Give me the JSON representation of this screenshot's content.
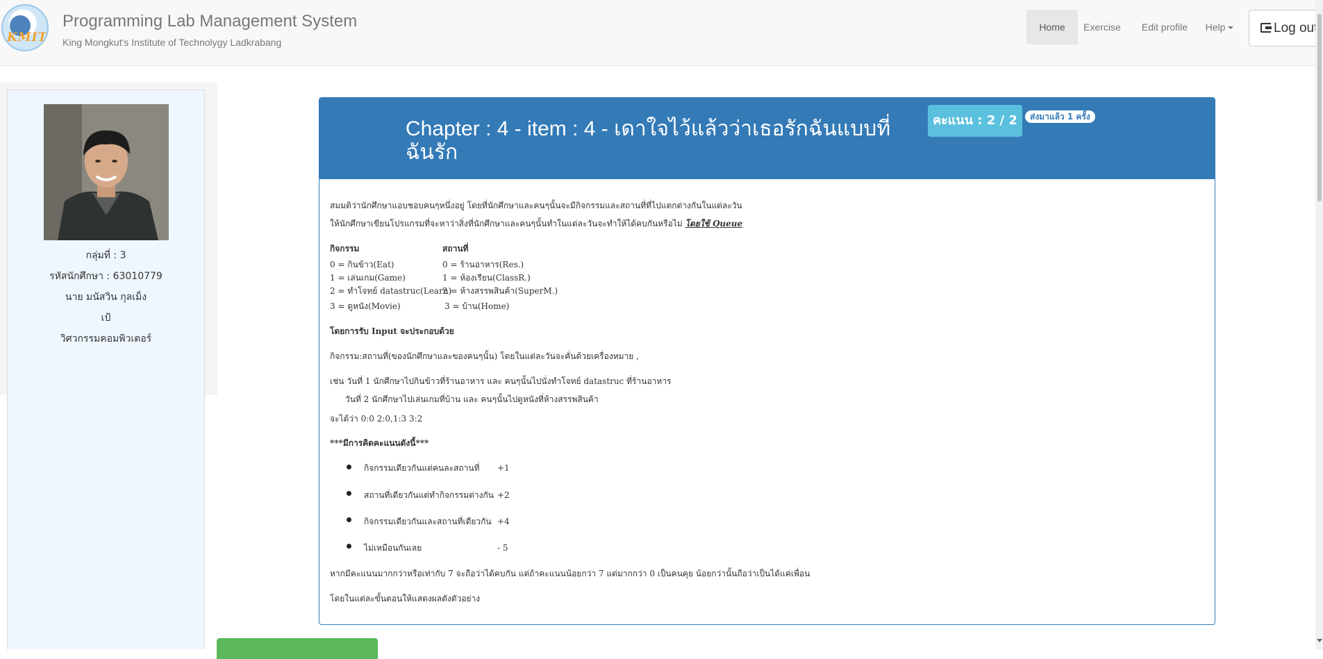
{
  "header": {
    "title": "Programming Lab Management System",
    "subtitle": "King Mongkut's Institute of Technolygy Ladkrabang",
    "logo_text": "KMITL",
    "nav": {
      "home": "Home",
      "exercise": "Exercise",
      "edit_profile": "Edit profile",
      "help": "Help",
      "logout": "Log out"
    }
  },
  "profile": {
    "group": "กลุ่มที่ : 3",
    "student_id": "รหัสนักศึกษา : 63010779",
    "name": "นาย มนัสวิน กุลเม็ง",
    "nickname": "เป้",
    "faculty": "วิศวกรรมคอมพิวเตอร์"
  },
  "problem": {
    "title": "Chapter : 4 - item : 4 - เดาใจไว้แล้วว่าเธอรักฉันแบบที่ฉันรัก",
    "score": "คะแนน : 2 / 2",
    "submitted": "ส่งมาแล้ว 1 ครั้ง",
    "intro1": "สมมติว่านักศึกษาแอบชอบคนๆหนึ่งอยู่ โดยที่นักศึกษาและคนๆนั้นจะมีกิจกรรมและสถานที่ที่ไปแตกต่างกันในแต่ละวัน",
    "intro2": "ให้นักศึกษาเขียนโปรแกรมที่จะหาว่าสิ่งที่นักศึกษาและคนๆนั้นทำในแต่ละวันจะทำให้ได้คบกันหรือไม่ ",
    "intro2_emph": "โดยใช้ Queue",
    "table": {
      "head_activity": "กิจกรรม",
      "head_place": "สถานที่",
      "activities": [
        "0 = กินข้าว(Eat)",
        "1 = เล่นเกม(Game)",
        "2 = ทำโจทย์ datastruc(Learn)",
        "3 = ดูหนัง(Movie)"
      ],
      "places": [
        "0 = ร้านอาหาร(Res.)",
        "1 = ห้องเรียน(ClassR.)",
        "2 = ห้างสรรพสินค้า(SuperM.)",
        "3 = บ้าน(Home)"
      ]
    },
    "input_heading": "โดยการรับ Input จะประกอบด้วย",
    "input_desc": "กิจกรรม:สถานที่(ของนักศึกษาและของคนๆนั้น) โดยในแต่ละวันจะคั่นด้วยเครื่องหมาย ,",
    "example1": "เช่น วันที่ 1 นักศึกษาไปกินข้าวที่ร้านอาหาร และ คนๆนั้นไปนั่งทำโจทย์ datastruc ที่ร้านอาหาร",
    "example2": "วันที่ 2 นักศึกษาไปเล่นเกมที่บ้าน และ คนๆนั้นไปดูหนังที่ห้างสรรพสินค้า",
    "example3": "จะได้ว่า 0:0 2:0,1:3 3:2",
    "scoring_heading": "***มีการคิดคะแนนดังนี้***",
    "rules": [
      {
        "text": "กิจกรรมเดียวกันแต่คนละสถานที่",
        "score": "+1"
      },
      {
        "text": "สถานที่เดียวกันแต่ทำกิจกรรมต่างกัน",
        "score": "+2"
      },
      {
        "text": "กิจกรรมเดียวกันและสถานที่เดียวกัน",
        "score": "+4"
      },
      {
        "text": "ไม่เหมือนกันเลย",
        "score": "- 5"
      }
    ],
    "conclusion": "หากมีคะแนนมากกว่าหรือเท่ากับ 7 จะถือว่าได้คบกัน แต่ถ้าคะแนนน้อยกว่า 7 แต่มากกว่า 0 เป็นคนคุย น้อยกว่านั้นถือว่าเป็นได้แค่เพื่อน",
    "last_line": "โดยในแต่ละขั้นตอนให้แสดงผลดังตัวอย่าง"
  },
  "colors": {
    "primary": "#337ab7",
    "info": "#5bc0de",
    "success": "#5cb85c",
    "sidebar_bg": "#eef6fe"
  }
}
